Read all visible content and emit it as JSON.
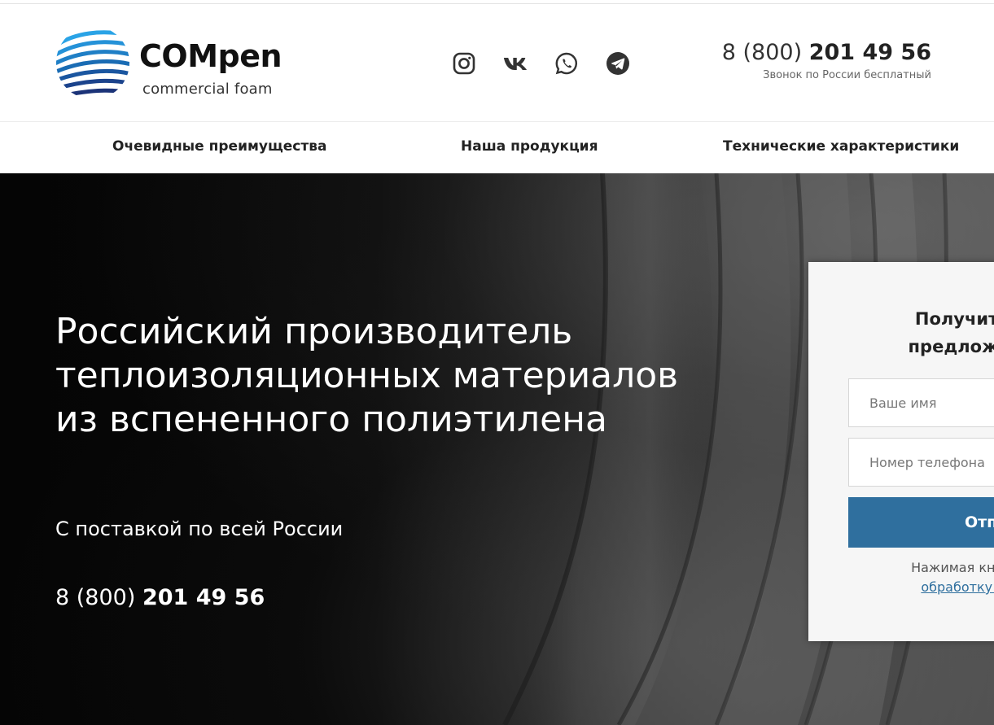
{
  "header": {
    "logo": {
      "name": "COMpen",
      "tagline": "commercial foam"
    },
    "socials": [
      {
        "icon": "instagram-icon"
      },
      {
        "icon": "vk-icon"
      },
      {
        "icon": "whatsapp-icon"
      },
      {
        "icon": "telegram-icon"
      }
    ],
    "phone": {
      "prefix": "8 (800) ",
      "number": "201 49 56",
      "note": "Звонок по России бесплатный"
    }
  },
  "nav": {
    "items": [
      {
        "label": "Очевидные преимущества"
      },
      {
        "label": "Наша продукция"
      },
      {
        "label": "Технические характеристики"
      }
    ]
  },
  "hero": {
    "title": "Российский производитель теплоизоляционных материалов из вспененного полиэтилена",
    "subtitle": "С поставкой по всей России",
    "phone": {
      "prefix": "8 (800) ",
      "number": "201 49 56"
    }
  },
  "form": {
    "title_line1": "Получите к",
    "title_line2": "предложени",
    "name_placeholder": "Ваше имя",
    "phone_placeholder": "Номер телефона",
    "submit_label": "Отп",
    "consent_text": "Нажимая кнопку,",
    "consent_link": "обработку пер"
  },
  "colors": {
    "accent": "#2f6f9e",
    "logo_blue": "#1a6fc0",
    "logo_navy": "#1b2f6b"
  }
}
